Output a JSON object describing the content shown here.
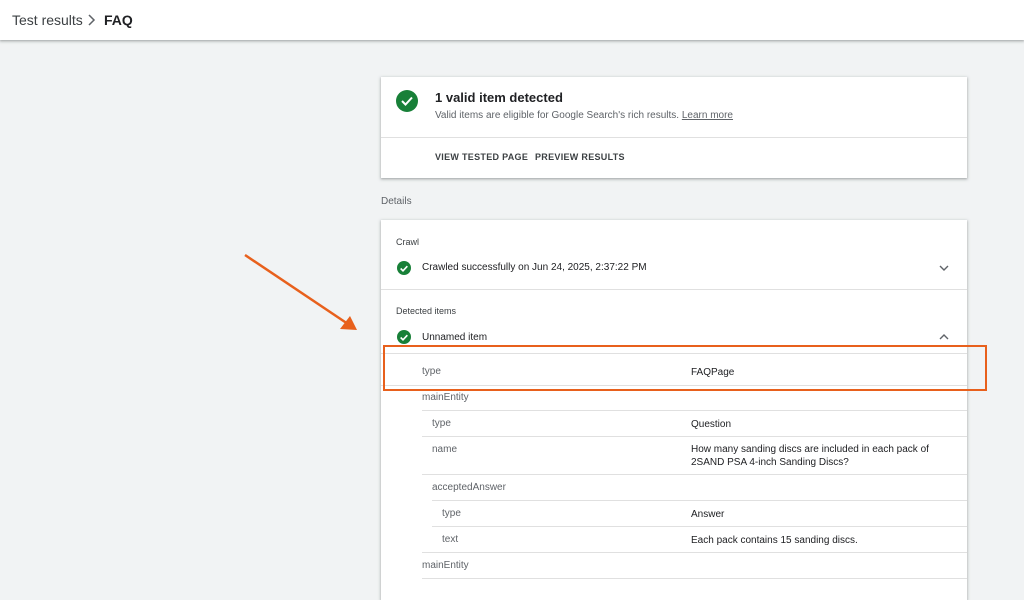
{
  "header": {
    "breadcrumb": [
      "Test results",
      "FAQ"
    ]
  },
  "summary": {
    "title": "1 valid item detected",
    "subtitle": "Valid items are eligible for Google Search's rich results.",
    "learn_more": "Learn more",
    "actions": [
      "VIEW TESTED PAGE",
      "PREVIEW RESULTS"
    ]
  },
  "details_label": "Details",
  "crawl": {
    "label": "Crawl",
    "status": "Crawled successfully on Jun 24, 2025, 2:37:22 PM"
  },
  "detected": {
    "label": "Detected items",
    "item_name": "Unnamed item",
    "properties": [
      {
        "key": "type",
        "value": "FAQPage"
      },
      {
        "key": "mainEntity",
        "value": ""
      },
      {
        "key": "type",
        "value": "Question"
      },
      {
        "key": "name",
        "value": "How many sanding discs are included in each pack of 2SAND PSA 4-inch Sanding Discs?"
      },
      {
        "key": "acceptedAnswer",
        "value": ""
      },
      {
        "key": "type",
        "value": "Answer"
      },
      {
        "key": "text",
        "value": "Each pack contains 15 sanding discs."
      },
      {
        "key": "mainEntity",
        "value": ""
      }
    ]
  },
  "colors": {
    "success": "#188038",
    "annotation": "#e8601c"
  },
  "icons": [
    "chevron-right-icon",
    "check-circle-icon",
    "chevron-down-icon",
    "chevron-up-icon",
    "annotation-arrow-icon"
  ]
}
